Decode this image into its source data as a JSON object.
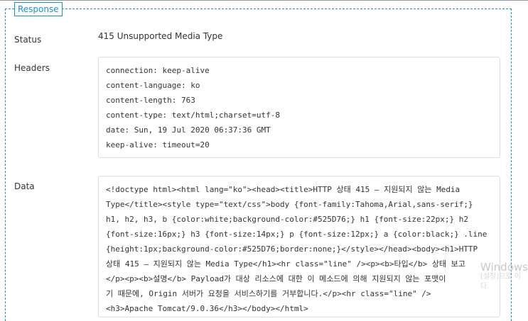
{
  "legend": "Response",
  "status": {
    "label": "Status",
    "value": "415 Unsupported Media Type"
  },
  "headers": {
    "label": "Headers",
    "lines": [
      "connection: keep-alive",
      "content-language: ko",
      "content-length: 763",
      "content-type: text/html;charset=utf-8",
      "date: Sun, 19 Jul 2020 06:37:36 GMT",
      "keep-alive: timeout=20"
    ]
  },
  "data": {
    "label": "Data",
    "lines": [
      "<!doctype html><html lang=\"ko\"><head><title>HTTP 상태 415 – 지원되지 않는 Media",
      "Type</title><style type=\"text/css\">body {font-family:Tahoma,Arial,sans-serif;}",
      "h1, h2, h3, b {color:white;background-color:#525D76;} h1 {font-size:22px;} h2",
      "{font-size:16px;} h3 {font-size:14px;} p {font-size:12px;} a {color:black;} .line",
      "{height:1px;background-color:#525D76;border:none;}</style></head><body><h1>HTTP",
      "상태 415 – 지원되지 않는 Media Type</h1><hr class=\"line\" /><p><b>타입</b> 상태 보고",
      "</p><p><b>설명</b> Payload가 대상 리소스에 대한 이 메소드에 의해 지원되지 않는 포맷이",
      "기 때문에, Origin 서버가 요청을 서비스하기를 거부합니다.</p><hr class=\"line\" />",
      "<h3>Apache Tomcat/9.0.36</h3></body></html>"
    ]
  },
  "watermark": {
    "title": "Windows",
    "line1": "[설정]으로 이",
    "line2": "다."
  }
}
